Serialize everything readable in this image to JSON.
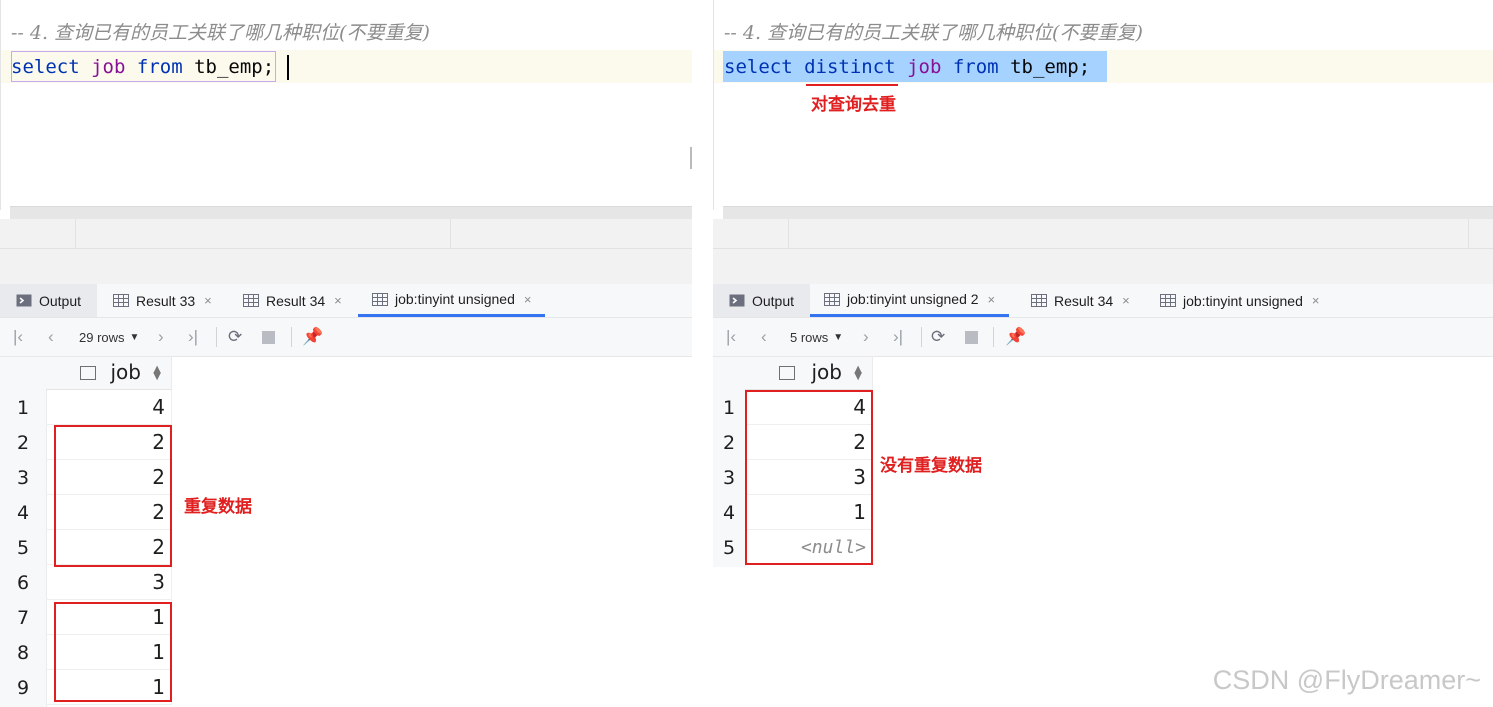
{
  "left": {
    "comment": "-- 4. 查询已有的员工关联了哪几种职位(不要重复)",
    "query": {
      "kw1": "select",
      "col": "job",
      "kw2": "from",
      "table": "tb_emp",
      "end": ";"
    },
    "tabs": [
      {
        "label": "Output",
        "icon": "output-icon"
      },
      {
        "label": "Result 33",
        "icon": "table-icon"
      },
      {
        "label": "Result 34",
        "icon": "table-icon"
      },
      {
        "label": "job:tinyint unsigned",
        "icon": "table-icon"
      }
    ],
    "rows_label": "29 rows",
    "column": "job",
    "rows": [
      {
        "n": "1",
        "v": "4"
      },
      {
        "n": "2",
        "v": "2"
      },
      {
        "n": "3",
        "v": "2"
      },
      {
        "n": "4",
        "v": "2"
      },
      {
        "n": "5",
        "v": "2"
      },
      {
        "n": "6",
        "v": "3"
      },
      {
        "n": "7",
        "v": "1"
      },
      {
        "n": "8",
        "v": "1"
      },
      {
        "n": "9",
        "v": "1"
      }
    ],
    "annotation": "重复数据"
  },
  "right": {
    "comment": "-- 4. 查询已有的员工关联了哪几种职位(不要重复)",
    "query": {
      "kw1": "select",
      "kw_distinct": "distinct",
      "col": "job",
      "kw2": "from",
      "table": "tb_emp",
      "end": ";"
    },
    "distinct_annotation": "对查询去重",
    "tabs": [
      {
        "label": "Output",
        "icon": "output-icon"
      },
      {
        "label": "job:tinyint unsigned 2",
        "icon": "table-icon"
      },
      {
        "label": "Result 34",
        "icon": "table-icon"
      },
      {
        "label": "job:tinyint unsigned",
        "icon": "table-icon"
      }
    ],
    "rows_label": "5 rows",
    "column": "job",
    "rows": [
      {
        "n": "1",
        "v": "4"
      },
      {
        "n": "2",
        "v": "2"
      },
      {
        "n": "3",
        "v": "3"
      },
      {
        "n": "4",
        "v": "1"
      },
      {
        "n": "5",
        "v": "<null>"
      }
    ],
    "annotation": "没有重复数据"
  },
  "close_glyph": "×",
  "watermark": "CSDN @FlyDreamer~",
  "colors": {
    "keyword": "#0033b3",
    "identifier": "#871094",
    "annotation": "#e02020",
    "selection": "#a6d2ff",
    "active_tab": "#3574f0"
  }
}
